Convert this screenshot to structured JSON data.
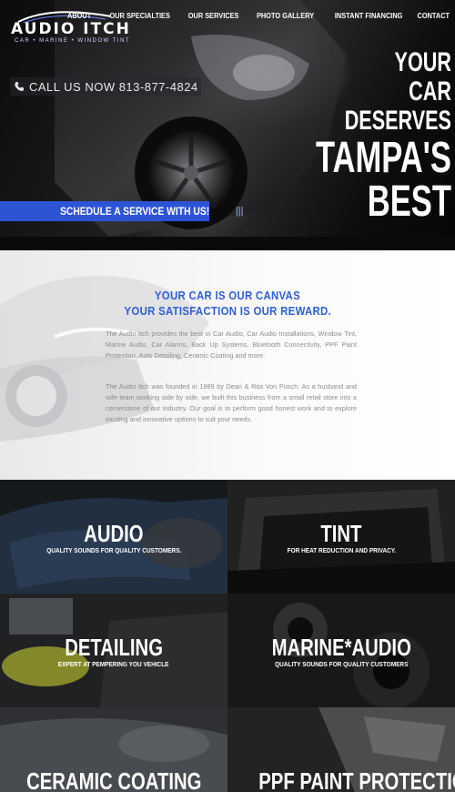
{
  "brand": {
    "logo_text": "AUDIO ITCH",
    "logo_sub": "CAR • MARINE • WINDOW TINT"
  },
  "nav": {
    "items": [
      {
        "label": "ABOUT"
      },
      {
        "label": "OUR SPECIALTIES"
      },
      {
        "label": "OUR SERVICES"
      },
      {
        "label": "PHOTO GALLERY"
      },
      {
        "label": "INSTANT FINANCING"
      },
      {
        "label": "CONTACT"
      }
    ]
  },
  "hero": {
    "call_text": "CALL US NOW 813-877-4824",
    "headline": [
      "YOUR",
      "CAR",
      "DESERVES",
      "TAMPA'S",
      "BEST"
    ],
    "schedule_label": "SCHEDULE A SERVICE WITH US!",
    "schedule_bars": "|||"
  },
  "about": {
    "title_line1": "YOUR CAR IS OUR CANVAS",
    "title_line2": "YOUR SATISFACTION IS OUR REWARD.",
    "paragraph1": "The Audio Itch provides the best in Car Audio, Car Audio Installations, Window Tint, Marine Audio, Car Alarms, Back Up Systems, Bluetooth Connectivity, PPF Paint Protection, Auto Detailing, Ceramic Coating and more.",
    "paragraph2": "The Audio Itch was founded in 1989 by Dean & Rita Von Pusch. As a husband and wife team working side by side, we built this business from a small retail store into a cornerstone of our industry. Our goal is to perform good honest work and to explore exciting and innovative options to suit your needs."
  },
  "services": [
    {
      "title": "AUDIO",
      "subtitle": "QUALITY SOUNDS FOR QUALITY CUSTOMERS."
    },
    {
      "title": "TINT",
      "subtitle": "FOR HEAT REDUCTION AND PRIVACY."
    },
    {
      "title": "DETAILING",
      "subtitle": "EXPERT AT PEMPERING YOU VEHICLE"
    },
    {
      "title": "MARINE*AUDIO",
      "subtitle": "QUALITY SOUNDS FOR QUALITY CUSTOMERS"
    },
    {
      "title": "CERAMIC COATING",
      "subtitle": ""
    },
    {
      "title": "PPF PAINT PROTECTION",
      "subtitle": ""
    }
  ],
  "colors": {
    "accent_blue": "#2e54d6",
    "title_blue": "#2e5fd6"
  }
}
